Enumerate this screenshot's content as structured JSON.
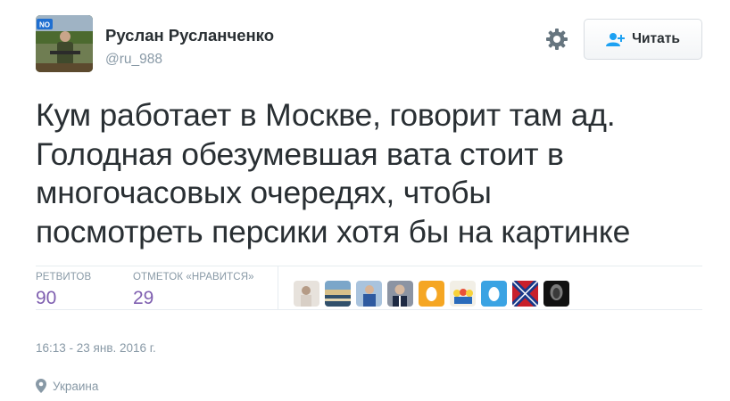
{
  "author": {
    "name": "Руслан Русланченко",
    "handle": "@ru_988",
    "avatar_badge": "NO"
  },
  "follow_button": {
    "label": "Читать",
    "icon": "add-user-icon"
  },
  "settings": {
    "icon": "gear-icon"
  },
  "tweet": {
    "text": "Кум работает в Москве, говорит там ад.\nГолодная обезумевшая вата стоит в\nмногочасовых очередях, чтобы\nпосмотреть персики хотя бы на картинке"
  },
  "stats": {
    "retweets_label": "Ретвитов",
    "retweets_value": "90",
    "likes_label": "Отметок «Нравится»",
    "likes_value": "29"
  },
  "likers": [
    {
      "icon": "user-avatar-1"
    },
    {
      "icon": "user-avatar-2"
    },
    {
      "icon": "user-avatar-3"
    },
    {
      "icon": "user-avatar-4"
    },
    {
      "icon": "default-egg-avatar-orange"
    },
    {
      "icon": "user-avatar-6"
    },
    {
      "icon": "default-egg-avatar-blue"
    },
    {
      "icon": "flag-avatar"
    },
    {
      "icon": "user-avatar-9"
    }
  ],
  "timestamp": "16:13 - 23 янв. 2016 г.",
  "location": {
    "icon": "location-pin-icon",
    "text": "Украина"
  },
  "colors": {
    "text": "#292f33",
    "muted": "#8899a6",
    "stat_value": "#7f5fb0",
    "accent": "#1da1f2",
    "divider": "#e6ecf0"
  }
}
